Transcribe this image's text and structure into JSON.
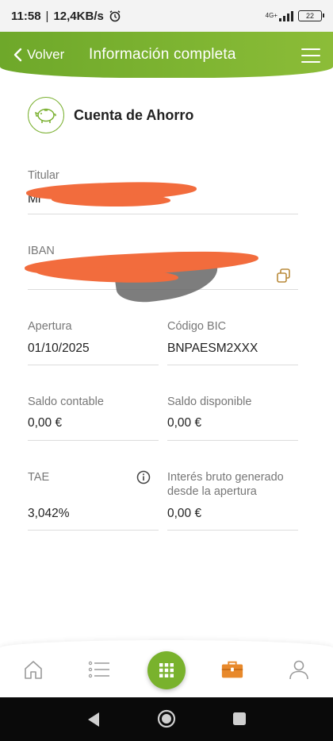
{
  "status_bar": {
    "time": "11:58",
    "separator": "|",
    "speed": "12,4KB/s",
    "network": "4G+",
    "battery": "22"
  },
  "header": {
    "back_label": "Volver",
    "title": "Información completa"
  },
  "account": {
    "title": "Cuenta de Ahorro",
    "icon": "piggy-bank-icon"
  },
  "fields": {
    "holder": {
      "label": "Titular",
      "value": "Mi"
    },
    "iban": {
      "label": "IBAN",
      "value": ""
    },
    "opening": {
      "label": "Apertura",
      "value": "01/10/2025"
    },
    "bic": {
      "label": "Código BIC",
      "value": "BNPAESM2XXX"
    },
    "accounting_balance": {
      "label": "Saldo contable",
      "value": "0,00 €"
    },
    "available_balance": {
      "label": "Saldo disponible",
      "value": "0,00 €"
    },
    "tae": {
      "label": "TAE",
      "value": "3,042%"
    },
    "gross_interest": {
      "label": "Interés bruto generado desde la apertura",
      "value": "0,00 €"
    }
  },
  "bottom_nav": {
    "items": [
      "home-icon",
      "list-icon",
      "grid-icon",
      "briefcase-icon",
      "user-icon"
    ],
    "active": "briefcase-icon"
  },
  "colors": {
    "brand_green": "#7ab030",
    "active_orange": "#e8892b",
    "redaction": "#f26c3d"
  }
}
